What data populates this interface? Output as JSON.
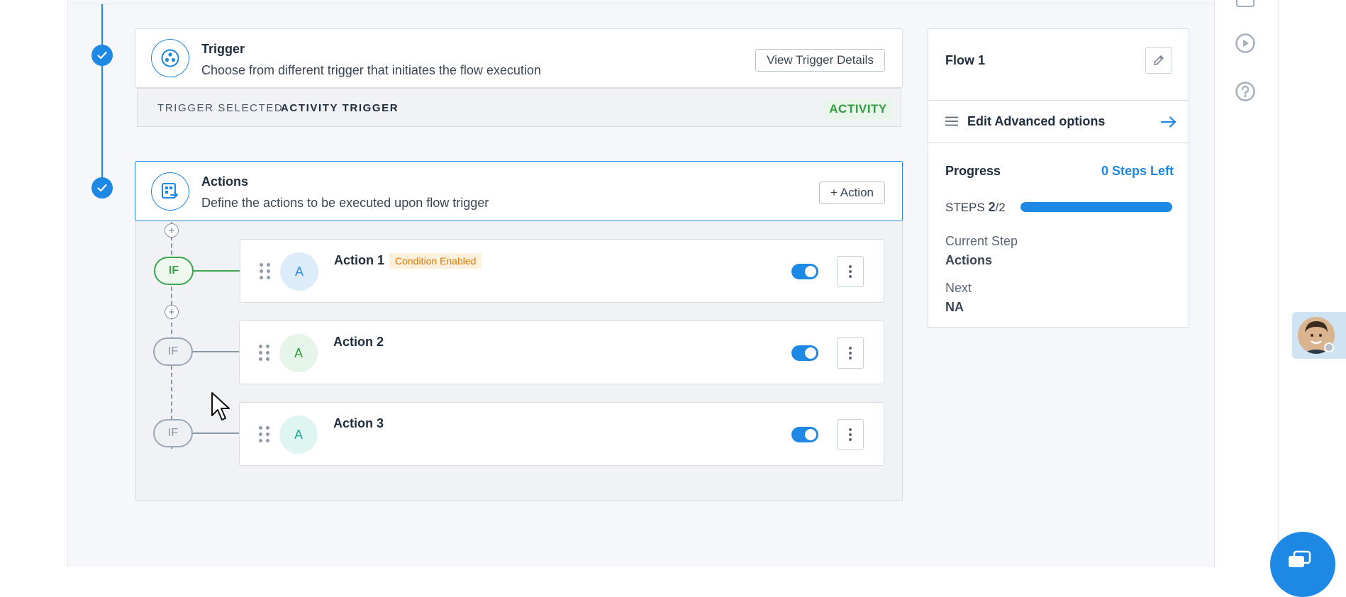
{
  "trigger": {
    "title": "Trigger",
    "subtitle": "Choose from different trigger that initiates the flow execution",
    "button_label": "View Trigger Details",
    "selected_label": "TRIGGER SELECTED",
    "selected_value": "ACTIVITY TRIGGER",
    "badge": "ACTIVITY"
  },
  "actions_section": {
    "title": "Actions",
    "subtitle": "Define the actions to be executed upon flow trigger",
    "add_button_label": "+ Action",
    "items": [
      {
        "name": "Action 1",
        "avatar": "A",
        "if_label": "IF",
        "condition_badge": "Condition Enabled",
        "enabled": true
      },
      {
        "name": "Action 2",
        "avatar": "A",
        "if_label": "IF",
        "enabled": true
      },
      {
        "name": "Action 3",
        "avatar": "A",
        "if_label": "IF",
        "enabled": true
      }
    ]
  },
  "sidebar": {
    "flow_name": "Flow 1",
    "advanced_options_label": "Edit Advanced options",
    "progress_label": "Progress",
    "steps_left": "0 Steps Left",
    "steps_label": "STEPS",
    "steps_current": "2",
    "steps_total": "/2",
    "progress_fraction": 1.0,
    "current_step_label": "Current Step",
    "current_step_value": "Actions",
    "next_label": "Next",
    "next_value": "NA"
  },
  "colors": {
    "accent": "#1e88e5",
    "success": "#3aa64a",
    "warning_bg": "#fdf0dc",
    "warning_text": "#e07b00"
  },
  "icons": [
    "check-icon",
    "trigger-icon",
    "actions-icon",
    "pencil-icon",
    "menu-icon",
    "arrow-right-icon",
    "play-icon",
    "help-icon",
    "drag-handle-icon",
    "kebab-icon",
    "plus-icon",
    "chat-icon",
    "cursor-icon"
  ]
}
